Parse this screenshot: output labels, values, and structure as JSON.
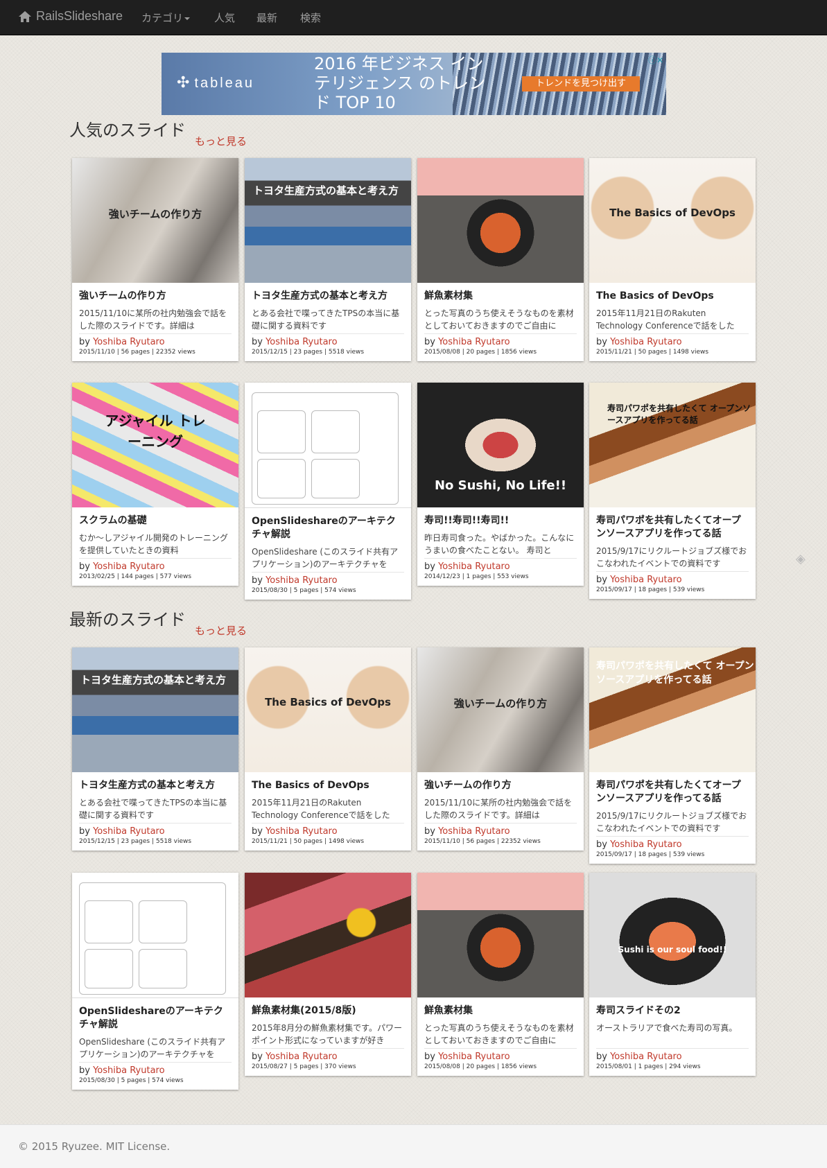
{
  "navbar": {
    "brand": "RailsSlideshare",
    "items": [
      {
        "label": "カテゴリ"
      },
      {
        "label": "人気"
      },
      {
        "label": "最新"
      },
      {
        "label": "検索"
      }
    ]
  },
  "ad": {
    "logo": "tableau",
    "headline": "2016 年ビジネス インテリジェンス のトレンド TOP 10",
    "cta": "トレンドを見つけ出す"
  },
  "sections": [
    {
      "title": "人気のスライド",
      "more": "もっと見る",
      "cards": [
        {
          "thumb_text": "強いチームの作り方",
          "title": "強いチームの作り方",
          "desc": "2015/11/10に某所の社内勉強会で話をした際のスライドです。詳細は",
          "by": "by",
          "author": "Yoshiba Ryutaro",
          "meta": "2015/11/10 | 56 pages | 22352 views"
        },
        {
          "thumb_text": "トヨタ生産方式の基本と考え方",
          "title": "トヨタ生産方式の基本と考え方",
          "desc": "とある会社で喋ってきたTPSの本当に基礎に関する資料です",
          "by": "by",
          "author": "Yoshiba Ryutaro",
          "meta": "2015/12/15 | 23 pages | 5518 views"
        },
        {
          "thumb_text": "",
          "title": "鮮魚素材集",
          "desc": "とった写真のうち使えそうなものを素材としておいておきますのでご自由に",
          "by": "by",
          "author": "Yoshiba Ryutaro",
          "meta": "2015/08/08 | 20 pages | 1856 views"
        },
        {
          "thumb_text": "The Basics of DevOps",
          "title": "The Basics of DevOps",
          "desc": "2015年11月21日のRakuten Technology Conferenceで話をした",
          "by": "by",
          "author": "Yoshiba Ryutaro",
          "meta": "2015/11/21 | 50 pages | 1498 views"
        },
        {
          "thumb_text": "アジャイル トレーニング",
          "title": "スクラムの基礎",
          "desc": "むか〜しアジャイル開発のトレーニングを提供していたときの資料",
          "by": "by",
          "author": "Yoshiba Ryutaro",
          "meta": "2013/02/25 | 144 pages | 577 views"
        },
        {
          "thumb_text": "",
          "title": "OpenSlideshareのアーキテクチャ解説",
          "desc": "OpenSlideshare (このスライド共有アプリケーション)のアーキテクチャを",
          "by": "by",
          "author": "Yoshiba Ryutaro",
          "meta": "2015/08/30 | 5 pages | 574 views"
        },
        {
          "thumb_text": "No Sushi, No Life!!",
          "title": "寿司!!寿司!!寿司!!",
          "desc": "昨日寿司食った。やばかった。こんなにうまいの食べたことない。 寿司と",
          "by": "by",
          "author": "Yoshiba Ryutaro",
          "meta": "2014/12/23 | 1 pages | 553 views"
        },
        {
          "thumb_text": "寿司パワポを共有したくて オープンソースアプリを作ってる話",
          "title": "寿司パワポを共有したくてオープンソースアプリを作ってる話",
          "desc": "2015/9/17にリクルートジョブズ様でおこなわれたイベントでの資料です",
          "by": "by",
          "author": "Yoshiba Ryutaro",
          "meta": "2015/09/17 | 18 pages | 539 views"
        }
      ]
    },
    {
      "title": "最新のスライド",
      "more": "もっと見る",
      "cards": [
        {
          "thumb_text": "トヨタ生産方式の基本と考え方",
          "title": "トヨタ生産方式の基本と考え方",
          "desc": "とある会社で喋ってきたTPSの本当に基礎に関する資料です",
          "by": "by",
          "author": "Yoshiba Ryutaro",
          "meta": "2015/12/15 | 23 pages | 5518 views"
        },
        {
          "thumb_text": "The Basics of DevOps",
          "title": "The Basics of DevOps",
          "desc": "2015年11月21日のRakuten Technology Conferenceで話をした",
          "by": "by",
          "author": "Yoshiba Ryutaro",
          "meta": "2015/11/21 | 50 pages | 1498 views"
        },
        {
          "thumb_text": "強いチームの作り方",
          "title": "強いチームの作り方",
          "desc": "2015/11/10に某所の社内勉強会で話をした際のスライドです。詳細は",
          "by": "by",
          "author": "Yoshiba Ryutaro",
          "meta": "2015/11/10 | 56 pages | 22352 views"
        },
        {
          "thumb_text": "寿司パワポを共有したくて オープンソースアプリを作ってる話",
          "title": "寿司パワポを共有したくてオープンソースアプリを作ってる話",
          "desc": "2015/9/17にリクルートジョブズ様でおこなわれたイベントでの資料です",
          "by": "by",
          "author": "Yoshiba Ryutaro",
          "meta": "2015/09/17 | 18 pages | 539 views"
        },
        {
          "thumb_text": "",
          "title": "OpenSlideshareのアーキテクチャ解説",
          "desc": "OpenSlideshare (このスライド共有アプリケーション)のアーキテクチャを",
          "by": "by",
          "author": "Yoshiba Ryutaro",
          "meta": "2015/08/30 | 5 pages | 574 views"
        },
        {
          "thumb_text": "",
          "title": "鮮魚素材集(2015/8版)",
          "desc": "2015年8月分の鮮魚素材集です。パワーポイント形式になっていますが好き",
          "by": "by",
          "author": "Yoshiba Ryutaro",
          "meta": "2015/08/27 | 5 pages | 370 views"
        },
        {
          "thumb_text": "",
          "title": "鮮魚素材集",
          "desc": "とった写真のうち使えそうなものを素材としておいておきますのでご自由に",
          "by": "by",
          "author": "Yoshiba Ryutaro",
          "meta": "2015/08/08 | 20 pages | 1856 views"
        },
        {
          "thumb_text": "Sushi is our soul food!!",
          "title": "寿司スライドその2",
          "desc": "オーストラリアで食べた寿司の写真。",
          "by": "by",
          "author": "Yoshiba Ryutaro",
          "meta": "2015/08/01 | 1 pages | 294 views"
        }
      ]
    }
  ],
  "footer": "© 2015  Ryuzee. MIT License."
}
